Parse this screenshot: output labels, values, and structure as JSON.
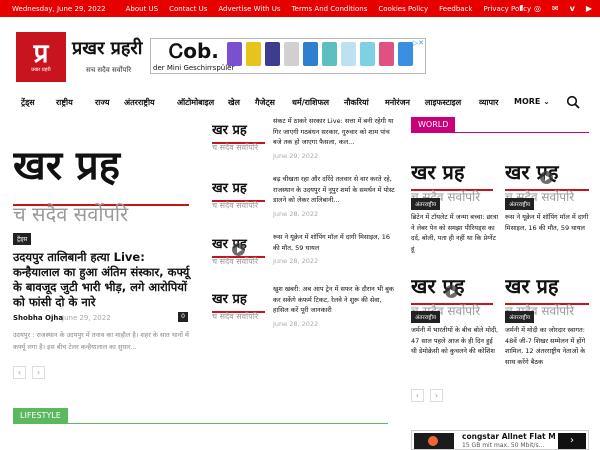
{
  "topbar": {
    "date": "Wednesday, June 29, 2022",
    "links": [
      "About US",
      "Contact Us",
      "Advertise With Us",
      "Terms And Conditions",
      "Cookies Policy",
      "Feedback",
      "Privacy Policy"
    ],
    "socials": [
      "f",
      "◎",
      "✉",
      "v",
      "▶"
    ],
    "social_icons": [
      "facebook-icon",
      "instagram-icon",
      "mail-icon",
      "vimeo-icon",
      "youtube-icon"
    ],
    "color": "#e60000"
  },
  "logo": {
    "mark": "प्र",
    "mark_caption": "प्रखर प्रहरी",
    "title": "प्रखर प्रहरी",
    "tagline": "सच सदैव सर्वोपरि"
  },
  "ad": {
    "brand": "Ꮯob.",
    "subtitle": "der Mini Geschirrspüler",
    "close": "▷✕"
  },
  "nav": {
    "items": [
      "ट्रेंड्स",
      "राष्ट्रीय",
      "राज्य",
      "अंतरराष्ट्रीय",
      "ऑटोमोबाइल",
      "खेल",
      "गैजेट्स",
      "धर्म/राशिफल",
      "नौकरियां",
      "मनोरंजन",
      "लाइफस्टाइल",
      "व्यापार",
      "MORE"
    ],
    "more_chevron": "⌄"
  },
  "thumb_text": {
    "line1": "खर प्रह",
    "line2": "च सदैव सर्वोपरि"
  },
  "featured": {
    "category": "ट्रेंड्स",
    "title": "उदयपुर तालिबानी हत्या Live: कन्हैयालाल का हुआ अंतिम संस्कार, कर्फ्यू के बावजूद जुटी भारी भीड़, लगे आरोपियों को फांसी दो के नारे",
    "author": "Shobha Ojha",
    "date": "June 29, 2022",
    "comments": "0",
    "excerpt": "उदयपुर : राजस्थान के उदयपुर में तनाव का माहौल है। शहर के सात थानों में कर्फ्यू लगा है। इस बीच टेलर कन्हैयालाल का सुधार..."
  },
  "middle_list": [
    {
      "title": "संकट में ठाकरे सरकार Live: सत्ता में बनी रहेगी या गिर जाएगी गठबंधन सरकार, गुरुवार को शाम पांच बजे तक हो जाएगा फैसला, कल...",
      "date": "June 29, 2022"
    },
    {
      "title": "बढ़ चीखता रहा और दरिंदे तलवार से वार करते रहे, राजस्थान के उदयपुर में नूपुर शर्मा के समर्थन में पोस्ट डालने को लेकर तालिबानी...",
      "date": "June 28, 2022"
    },
    {
      "title": "रूस ने यूक्रेन में शॉपिंग मॉल में दागी मिसाइल, 16 की मौत, 59 घायल",
      "date": "June 28, 2022"
    },
    {
      "title": "खुश खबरी: अब आप ट्रेन में सफर के दौरान भी बुक कर सकेंगे कंफर्म टिकट, रेलवे ने शुरू की सेवा, हासिल करें पूरी जानकारी",
      "date": "June 28, 2022"
    }
  ],
  "world": {
    "label": "WORLD",
    "color": "#c8007a",
    "badge": "अंतरराष्ट्रीय",
    "items": [
      {
        "title": "ब्रिटेन में टॉयलेट में जन्मा बच्चा: छात्रा ने लेबर पेन को समझा पीरियड्स का दर्द, बोली, पता ही नहीं था कि प्रेग्नेंट हूं"
      },
      {
        "title": "रूस ने यूक्रेन में शॉपिंग मॉल में दागी मिसाइल, 16 की मौत, 59 घायल"
      },
      {
        "title": "जर्मनी में भारतीयों के बीच बोले मोदी, 47 साल पहले आज के ही दिन हुई थी डेमोक्रेसी को कुचलने की कोशिश"
      },
      {
        "title": "जर्मनी में मोदी का जोरदार स्वागत: 48वें जी-7 शिखर सम्मेलन में होंगे शामिल, 12 अंतरराष्ट्रीय नेताओं के साथ करेंगे बैठक"
      }
    ]
  },
  "lifestyle": {
    "label": "LIFESTYLE",
    "color": "#5cb85c"
  },
  "pager": {
    "prev": "‹",
    "next": "›"
  },
  "ad2": {
    "title": "congstar Allnet Flat M",
    "subtitle": "15 GB mit max. 50 Mbit/s...",
    "arrow": "›"
  }
}
